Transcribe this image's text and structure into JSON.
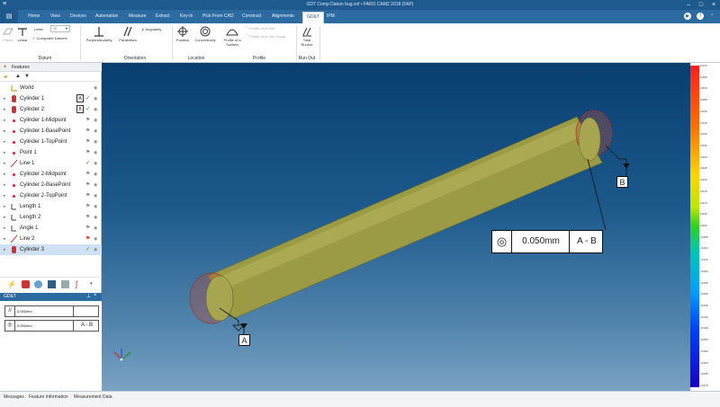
{
  "window": {
    "title": "GDT Comp Datum bug.xxf • FARO CAM2 2018 (FAP)"
  },
  "menu": {
    "tabs": [
      "Home",
      "View",
      "Devices",
      "Automation",
      "Measure",
      "Extract",
      "Key-In",
      "Pick From CAD",
      "Construct",
      "Alignments",
      "GD&T",
      "IPM"
    ],
    "active": "GD&T"
  },
  "ribbon": {
    "datum": {
      "label": "Datum",
      "buttons": [
        "Planar",
        "Linear"
      ],
      "letter_label": "Letter",
      "letter_value": "C",
      "composite": "Composite Datums"
    },
    "orientation": {
      "label": "Orientation",
      "buttons": [
        "Perpendicularity",
        "Parallelism"
      ],
      "angularity": "Angularity"
    },
    "location": {
      "label": "Location",
      "buttons": [
        "Position",
        "Concentricity"
      ]
    },
    "profile": {
      "label": "Profile",
      "buttons": [
        "Profile of a Surface"
      ],
      "disabled": [
        "Profile of a Line",
        "Profile of a Line Group"
      ]
    },
    "runout": {
      "label": "Run Out",
      "buttons": [
        "Total Runout"
      ]
    }
  },
  "features": {
    "header": "Features",
    "items": [
      {
        "label": "World",
        "type": "world",
        "datum": "",
        "status": "",
        "selected": false
      },
      {
        "label": "Cylinder 1",
        "type": "cylinder",
        "datum": "A",
        "status": "check",
        "selected": false
      },
      {
        "label": "Cylinder 2",
        "type": "cylinder",
        "datum": "B",
        "status": "check",
        "selected": false
      },
      {
        "label": "Cylinder 1-Midpoint",
        "type": "point",
        "datum": "",
        "status": "flag",
        "selected": false
      },
      {
        "label": "Cylinder 1-BasePoint",
        "type": "point",
        "datum": "",
        "status": "flag",
        "selected": false
      },
      {
        "label": "Cylinder 1-TopPoint",
        "type": "point",
        "datum": "",
        "status": "flag",
        "selected": false
      },
      {
        "label": "Point 1",
        "type": "point",
        "datum": "",
        "status": "flag",
        "selected": false
      },
      {
        "label": "Line 1",
        "type": "line",
        "datum": "",
        "status": "check",
        "selected": false
      },
      {
        "label": "Cylinder 2-Midpoint",
        "type": "point",
        "datum": "",
        "status": "flag",
        "selected": false
      },
      {
        "label": "Cylinder 2-BasePoint",
        "type": "point",
        "datum": "",
        "status": "flag",
        "selected": false
      },
      {
        "label": "Cylinder 2-TopPoint",
        "type": "point",
        "datum": "",
        "status": "flag",
        "selected": false
      },
      {
        "label": "Length 1",
        "type": "length",
        "datum": "",
        "status": "flag",
        "selected": false
      },
      {
        "label": "Length 2",
        "type": "length",
        "datum": "",
        "status": "flag",
        "selected": false
      },
      {
        "label": "Angle 1",
        "type": "angle",
        "datum": "",
        "status": "flag",
        "selected": false
      },
      {
        "label": "Line 2",
        "type": "line",
        "datum": "",
        "status": "redflag",
        "selected": false
      },
      {
        "label": "Cylinder 3",
        "type": "cylinder",
        "datum": "",
        "status": "check",
        "selected": true
      }
    ]
  },
  "gdt_panel": {
    "title": "GD&T",
    "rows": [
      {
        "symbol": "//",
        "value": "0.050mm",
        "datum": ""
      },
      {
        "symbol": "◎",
        "value": "0.050mm",
        "datum": "A - B"
      }
    ]
  },
  "viewport": {
    "fcf": {
      "symbol": "◎",
      "tolerance": "0.050mm",
      "datum": "A - B"
    },
    "datum_labels": [
      "A",
      "B"
    ]
  },
  "colorbar": {
    "labels": [
      "0.070",
      "0.065",
      "0.060",
      "0.055",
      "0.050",
      "0.045",
      "0.040",
      "0.035",
      "0.030",
      "0.025",
      "0.020",
      "0.015",
      "0.010",
      "0.005",
      "0.000",
      "-0.005",
      "-0.010",
      "-0.015",
      "-0.020",
      "-0.025",
      "-0.030",
      "-0.035",
      "-0.040",
      "-0.045",
      "-0.050",
      "-0.055",
      "-0.060",
      "-0.065",
      "-0.070"
    ]
  },
  "statusbar": {
    "tabs": [
      "Messages",
      "Feature Information",
      "Measurement Data"
    ]
  }
}
